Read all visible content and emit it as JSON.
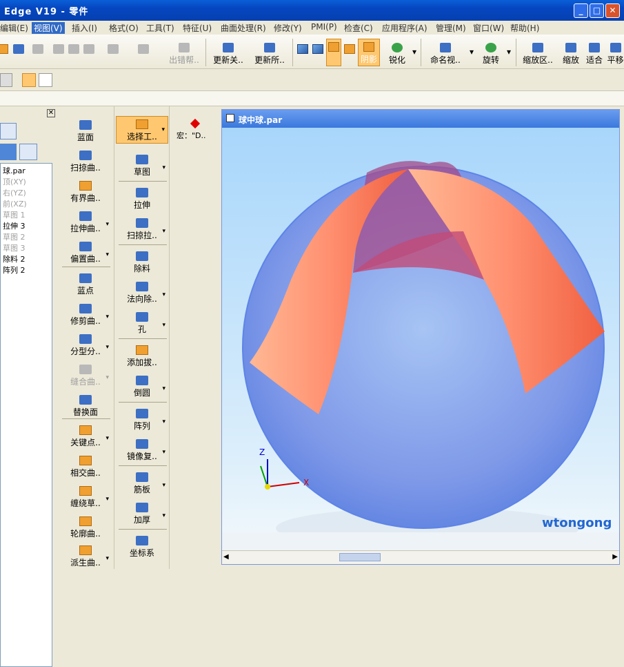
{
  "window": {
    "title": "Edge V19 - 零件",
    "buttons": [
      "_",
      "□",
      "✕"
    ]
  },
  "menu": [
    "编辑(E)",
    "视图(V)",
    "插入(I)",
    "格式(O)",
    "工具(T)",
    "特征(U)",
    "曲面处理(R)",
    "修改(Y)",
    "PMI(P)",
    "检查(C)",
    "应用程序(A)",
    "管理(M)",
    "窗口(W)",
    "帮助(H)"
  ],
  "toolbar": {
    "error": "出错帮..",
    "update_rel": "更新关..",
    "update_all": "更新所..",
    "shade": "阴影",
    "sharpen": "锐化",
    "named_view": "命名视..",
    "rotate": "旋转",
    "zoom_area": "缩放区..",
    "zoom": "缩放",
    "fit": "适合",
    "pan": "平移"
  },
  "pathfinder": {
    "file": "球.par",
    "items": [
      {
        "t": "顶(XY)",
        "dim": true
      },
      {
        "t": "右(YZ)",
        "dim": true
      },
      {
        "t": "前(XZ)",
        "dim": true
      },
      {
        "t": "草图 1",
        "dim": true
      },
      {
        "t": "拉伸 3",
        "dim": false
      },
      {
        "t": "草图 2",
        "dim": true
      },
      {
        "t": "草图 3",
        "dim": true
      },
      {
        "t": "除料 2",
        "dim": false
      },
      {
        "t": "阵列 2",
        "dim": false
      }
    ]
  },
  "col1": [
    "蓝面",
    "扫掠曲..",
    "有界曲..",
    "拉伸曲..",
    "偏置曲..",
    "蓝点",
    "修剪曲..",
    "分型分..",
    "缝合曲..",
    "替换面",
    "关键点..",
    "相交曲..",
    "缠绕草..",
    "轮廓曲..",
    "派生曲.."
  ],
  "col2": [
    "选择工..",
    "草图",
    "拉伸",
    "扫掠拉..",
    "除料",
    "法向除..",
    "孔",
    "添加拔..",
    "倒圆",
    "阵列",
    "镜像复..",
    "筋板",
    "加厚",
    "坐标系"
  ],
  "macro": "宏：\"D..",
  "doc": {
    "title": "球中球.par"
  },
  "axes": {
    "z": "Z",
    "x": "X"
  },
  "watermark": "wtongong"
}
